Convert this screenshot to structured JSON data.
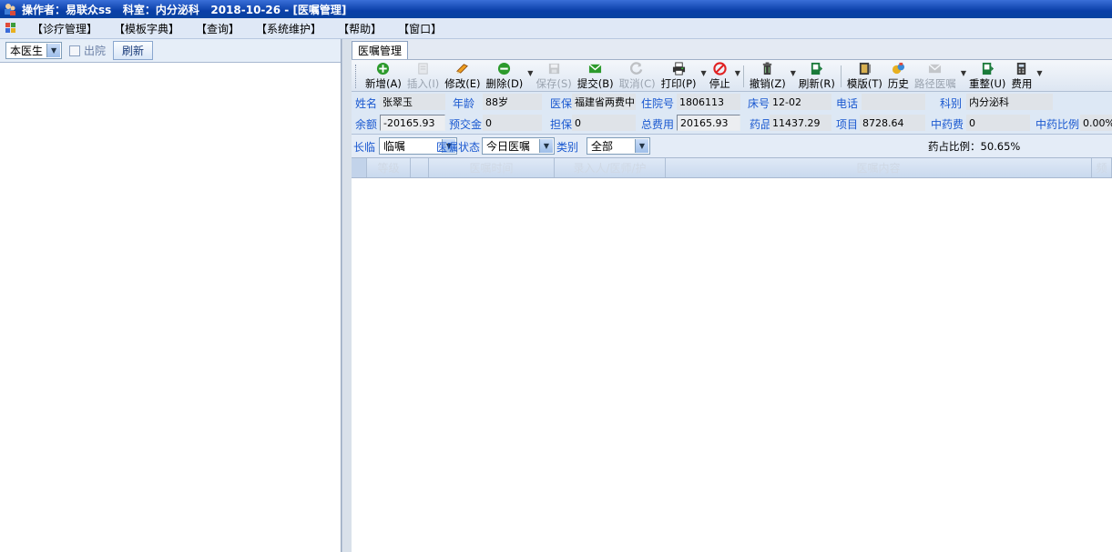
{
  "title": "操作者：易联众ss   科室：内分泌科   2018-10-26 - [医嘱管理]",
  "menu": [
    "【诊疗管理】",
    "【模板字典】",
    "【查询】",
    "【系统维护】",
    "【帮助】",
    "【窗口】"
  ],
  "left": {
    "doctor_select": "本医生",
    "discharged_label": "出院",
    "refresh_label": "刷新"
  },
  "tab_label": "医嘱管理",
  "toolbar": [
    {
      "label": "新增(A)",
      "icon": "add-icon",
      "enabled": true
    },
    {
      "label": "插入(I)",
      "icon": "insert-icon",
      "enabled": false
    },
    {
      "label": "修改(E)",
      "icon": "edit-icon",
      "enabled": true
    },
    {
      "label": "删除(D)",
      "icon": "delete-icon",
      "enabled": true,
      "dropdown": true
    },
    {
      "label": "保存(S)",
      "icon": "save-icon",
      "enabled": false
    },
    {
      "label": "提交(B)",
      "icon": "submit-icon",
      "enabled": true
    },
    {
      "label": "取消(C)",
      "icon": "cancel-icon",
      "enabled": false
    },
    {
      "label": "打印(P)",
      "icon": "print-icon",
      "enabled": true,
      "dropdown": true
    },
    {
      "label": "停止",
      "icon": "stop-icon",
      "enabled": true,
      "dropdown": true
    },
    {
      "label": "撤销(Z)",
      "icon": "revoke-icon",
      "enabled": true,
      "dropdown": true
    },
    {
      "label": "刷新(R)",
      "icon": "refresh-icon",
      "enabled": true
    },
    {
      "label": "模版(T)",
      "icon": "template-icon",
      "enabled": true
    },
    {
      "label": "历史",
      "icon": "history-icon",
      "enabled": true
    },
    {
      "label": "路径医嘱",
      "icon": "pathway-icon",
      "enabled": false,
      "dropdown": true
    },
    {
      "label": "重整(U)",
      "icon": "reorganize-icon",
      "enabled": true
    },
    {
      "label": "费用",
      "icon": "fee-icon",
      "enabled": true,
      "dropdown": true
    }
  ],
  "patient": {
    "name_label": "姓名",
    "name": "张翠玉",
    "age_label": "年龄",
    "age": "88岁",
    "insurance_label": "医保",
    "insurance": "福建省两费中",
    "admission_label": "住院号",
    "admission_no": "1806113",
    "bed_label": "床号",
    "bed": "12-02",
    "phone_label": "电话",
    "phone": "",
    "dept_label": "科别",
    "dept": "内分泌科",
    "balance_label": "余额",
    "balance": "-20165.93",
    "prepay_label": "预交金",
    "prepay": "0",
    "guarantee_label": "担保",
    "guarantee": "0",
    "total_label": "总费用",
    "total": "20165.93",
    "drug_label": "药品",
    "drug": "11437.29",
    "item_label": "项目",
    "item": "8728.64",
    "tcm_fee_label": "中药费",
    "tcm_fee": "0",
    "tcm_ratio_label": "中药比例",
    "tcm_ratio": "0.00%"
  },
  "filters": {
    "term_label": "长临",
    "term": "临嘱",
    "status_label": "医嘱状态",
    "status": "今日医嘱",
    "category_label": "类别",
    "category": "全部",
    "drug_ratio_label": "药占比例：",
    "drug_ratio": "50.65%"
  },
  "grid_headers": [
    "等级",
    "医嘱时间",
    "录入人/医师/护",
    "医嘱内容",
    "频"
  ]
}
